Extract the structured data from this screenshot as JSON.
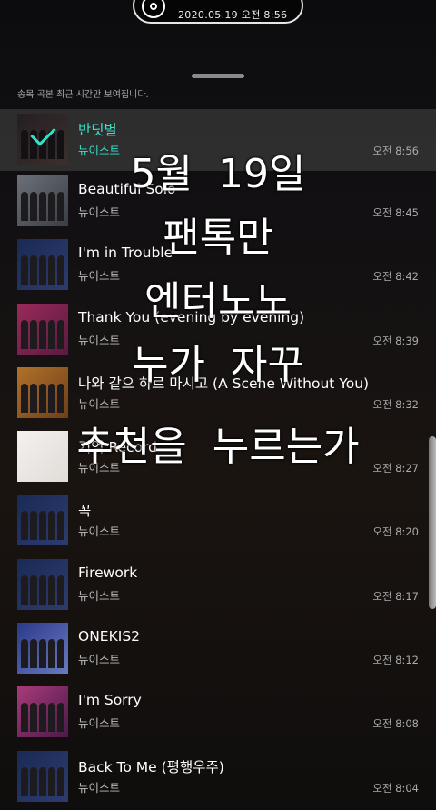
{
  "status": {
    "date_time": "2020.05.19 오전 8:56"
  },
  "notice": "송목 곡본 최근 시간만 보여집니다.",
  "colors": {
    "accent": "#35e0c4"
  },
  "tracks": [
    {
      "title": "반딧별",
      "artist": "뉴이스트",
      "time": "오전 8:56",
      "active": true,
      "art": [
        "#3a3035",
        "#5a4a45"
      ]
    },
    {
      "title": "Beautiful Solo",
      "artist": "뉴이스트",
      "time": "오전 8:45",
      "active": false,
      "art": [
        "#6b7078",
        "#3a3d44"
      ]
    },
    {
      "title": "I'm in Trouble",
      "artist": "뉴이스트",
      "time": "오전 8:42",
      "active": false,
      "art": [
        "#1a2a55",
        "#2d3c6e"
      ]
    },
    {
      "title": "Thank You (evening by evening)",
      "artist": "뉴이스트",
      "time": "오전 8:39",
      "active": false,
      "art": [
        "#9a2a5a",
        "#5a1a40"
      ]
    },
    {
      "title": "나와 같으 하르 마시고 (A Scene Without You)",
      "artist": "뉴이스트",
      "time": "오전 8:32",
      "active": false,
      "art": [
        "#b0712a",
        "#6e3f18"
      ]
    },
    {
      "title": "기억 Record",
      "artist": "뉴이스트",
      "time": "오전 8:27",
      "active": false,
      "art": [
        "#f4f1ee",
        "#e0dcd8"
      ]
    },
    {
      "title": "꼭",
      "artist": "뉴이스트",
      "time": "오전 8:20",
      "active": false,
      "art": [
        "#1a2a55",
        "#2d3c6e"
      ]
    },
    {
      "title": "Firework",
      "artist": "뉴이스트",
      "time": "오전 8:17",
      "active": false,
      "art": [
        "#1a2a55",
        "#2d3c6e"
      ]
    },
    {
      "title": "ONEKIS2",
      "artist": "뉴이스트",
      "time": "오전 8:12",
      "active": false,
      "art": [
        "#2a3a88",
        "#6a7ac0"
      ]
    },
    {
      "title": "I'm Sorry",
      "artist": "뉴이스트",
      "time": "오전 8:08",
      "active": false,
      "art": [
        "#a83a7a",
        "#4a1a48"
      ]
    },
    {
      "title": "Back To Me (평행우주)",
      "artist": "뉴이스트",
      "time": "오전 8:04",
      "active": false,
      "art": [
        "#1a2a55",
        "#2d3c6e"
      ]
    }
  ],
  "overlay_lines": [
    "5월  19일",
    "팬톡만",
    "엔터노노",
    "누가  자꾸",
    "추천을  누르는가"
  ]
}
